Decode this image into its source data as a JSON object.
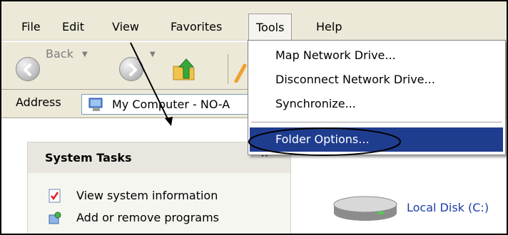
{
  "menubar": {
    "items": [
      "File",
      "Edit",
      "View",
      "Favorites",
      "Tools",
      "Help"
    ]
  },
  "toolbar": {
    "back_label": "Back",
    "back_icon": "back-arrow-icon",
    "forward_icon": "forward-arrow-icon",
    "up_icon": "folder-up-icon"
  },
  "addressbar": {
    "label": "Address",
    "value": "My Computer - NO-A",
    "icon": "my-computer-icon"
  },
  "tools_menu": {
    "items": [
      "Map Network Drive...",
      "Disconnect Network Drive...",
      "Synchronize...",
      "Folder Options..."
    ],
    "highlighted": "Folder Options...",
    "highlight_color": "#1f3d8f"
  },
  "tasks_panel": {
    "title": "System Tasks",
    "items": [
      "View system information",
      "Add or remove programs"
    ]
  },
  "drives": [
    {
      "label": "Local Disk (C:)",
      "icon": "hard-disk-icon"
    }
  ],
  "annotations": {
    "arrow_color": "#000000",
    "ellipse_target": "Folder Options..."
  }
}
